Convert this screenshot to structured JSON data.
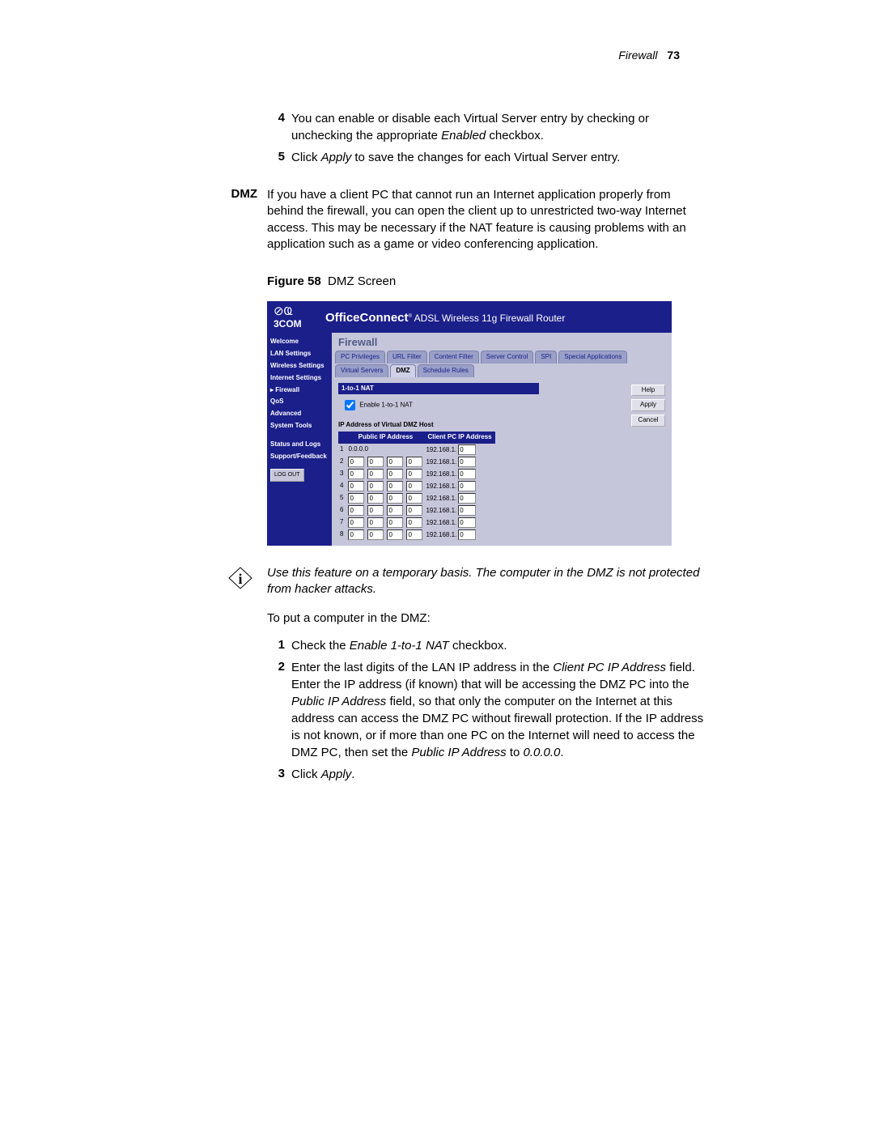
{
  "header": {
    "section": "Firewall",
    "page_num": "73"
  },
  "pre_steps": [
    {
      "n": "4",
      "text_a": "You can enable or disable each Virtual Server entry by checking or unchecking the appropriate ",
      "em1": "Enabled",
      "text_b": " checkbox."
    },
    {
      "n": "5",
      "text_a": "Click ",
      "em1": "Apply",
      "text_b": " to save the changes for each Virtual Server entry."
    }
  ],
  "dmz": {
    "heading": "DMZ",
    "body": "If you have a client PC that cannot run an Internet application properly from behind the firewall, you can open the client up to unrestricted two-way Internet access. This may be necessary if the NAT feature is causing problems with an application such as a game or video conferencing application."
  },
  "figure": {
    "label": "Figure 58",
    "caption": "DMZ Screen"
  },
  "router": {
    "brand_line1": "OfficeConnect",
    "brand_line2": "ADSL Wireless 11g Firewall Router",
    "logo_text": "3COM",
    "page_title": "Firewall",
    "nav": [
      "Welcome",
      "LAN Settings",
      "Wireless Settings",
      "Internet Settings",
      "Firewall",
      "QoS",
      "Advanced",
      "System Tools",
      "",
      "Status and Logs",
      "Support/Feedback"
    ],
    "logout": "LOG OUT",
    "tabs": [
      "PC Privileges",
      "URL Filter",
      "Content Filter",
      "Server Control",
      "SPI",
      "Special Applications",
      "Virtual Servers",
      "DMZ",
      "Schedule Rules"
    ],
    "active_tab": "DMZ",
    "buttons": {
      "help": "Help",
      "apply": "Apply",
      "cancel": "Cancel"
    },
    "section1": "1-to-1 NAT",
    "enable_label": "Enable 1-to-1 NAT",
    "enable_checked": true,
    "section2": "IP Address of Virtual DMZ Host",
    "col_public": "Public IP Address",
    "col_client": "Client PC IP Address",
    "client_prefix": "192.168.1.",
    "rows": [
      {
        "n": "1",
        "public_text": "0.0.0.0",
        "client_last": "0",
        "first": true
      },
      {
        "n": "2",
        "octets": [
          "0",
          "0",
          "0",
          "0"
        ],
        "client_last": "0"
      },
      {
        "n": "3",
        "octets": [
          "0",
          "0",
          "0",
          "0"
        ],
        "client_last": "0"
      },
      {
        "n": "4",
        "octets": [
          "0",
          "0",
          "0",
          "0"
        ],
        "client_last": "0"
      },
      {
        "n": "5",
        "octets": [
          "0",
          "0",
          "0",
          "0"
        ],
        "client_last": "0"
      },
      {
        "n": "6",
        "octets": [
          "0",
          "0",
          "0",
          "0"
        ],
        "client_last": "0"
      },
      {
        "n": "7",
        "octets": [
          "0",
          "0",
          "0",
          "0"
        ],
        "client_last": "0"
      },
      {
        "n": "8",
        "octets": [
          "0",
          "0",
          "0",
          "0"
        ],
        "client_last": "0"
      }
    ]
  },
  "info_note": "Use this feature on a temporary basis. The computer in the DMZ is not protected from hacker attacks.",
  "intro2": "To put a computer in the DMZ:",
  "steps2": [
    {
      "n": "1",
      "a": "Check the ",
      "e1": "Enable 1-to-1 NAT",
      "b": " checkbox."
    },
    {
      "n": "2",
      "a": "Enter the last digits of the LAN IP address in the ",
      "e1": "Client PC IP Address",
      "b": " field. Enter the IP address (if known) that will be accessing the DMZ PC into the ",
      "e2": "Public IP Address",
      "c": " field, so that only the computer on the Internet at this address can access the DMZ PC without firewall protection. If the IP address is not known, or if more than one PC on the Internet will need to access the DMZ PC, then set the ",
      "e3": "Public IP Address",
      "d": " to ",
      "e4": "0.0.0.0",
      "e": "."
    },
    {
      "n": "3",
      "a": "Click ",
      "e1": "Apply",
      "b": "."
    }
  ]
}
